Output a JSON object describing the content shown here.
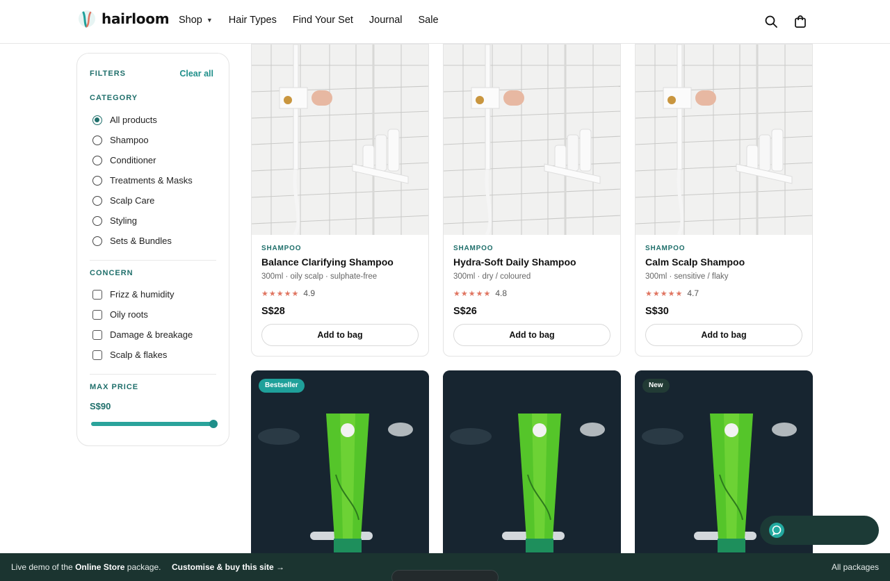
{
  "brand": {
    "name": "hairloom"
  },
  "nav": {
    "items": [
      "Shop",
      "Hair Types",
      "Find Your Set",
      "Journal",
      "Sale"
    ]
  },
  "icons": {
    "search": "search-icon",
    "bag": "shopping-bag-icon"
  },
  "colors": {
    "accent": "#1f6f6b",
    "teal": "#1fa09a",
    "star": "#e07561",
    "footer": "#1b3430"
  },
  "filters": {
    "title": "FILTERS",
    "clear_label": "Clear all",
    "category": {
      "title": "CATEGORY",
      "options": [
        "All products",
        "Shampoo",
        "Conditioner",
        "Treatments & Masks",
        "Scalp Care",
        "Styling",
        "Sets & Bundles"
      ],
      "selected": "All products"
    },
    "concern": {
      "title": "CONCERN",
      "options": [
        "Frizz & humidity",
        "Oily roots",
        "Damage & breakage",
        "Scalp & flakes"
      ]
    },
    "price": {
      "title": "MAX PRICE",
      "value": "S$90",
      "level": 1.0
    }
  },
  "products": [
    {
      "category": "SHAMPOO",
      "name": "Balance Clarifying Shampoo",
      "meta": "300ml · oily scalp · sulphate-free",
      "stars": "★★★★★",
      "rating": "4.9",
      "price": "S$28",
      "button": "Add to bag"
    },
    {
      "category": "SHAMPOO",
      "name": "Hydra-Soft Daily Shampoo",
      "meta": "300ml · dry / coloured",
      "stars": "★★★★★",
      "rating": "4.8",
      "price": "S$26",
      "button": "Add to bag"
    },
    {
      "category": "SHAMPOO",
      "name": "Calm Scalp Shampoo",
      "meta": "300ml · sensitive / flaky",
      "stars": "★★★★★",
      "rating": "4.7",
      "price": "S$30",
      "button": "Add to bag"
    }
  ],
  "products_row2": [
    {
      "badge": "Bestseller"
    },
    {
      "badge": ""
    },
    {
      "badge": "New"
    }
  ],
  "footer": {
    "demo_prefix": "Live demo of the",
    "demo_package": "Online Store",
    "demo_suffix": "package.",
    "cta": "Customise & buy this site →",
    "right": "All packages"
  }
}
